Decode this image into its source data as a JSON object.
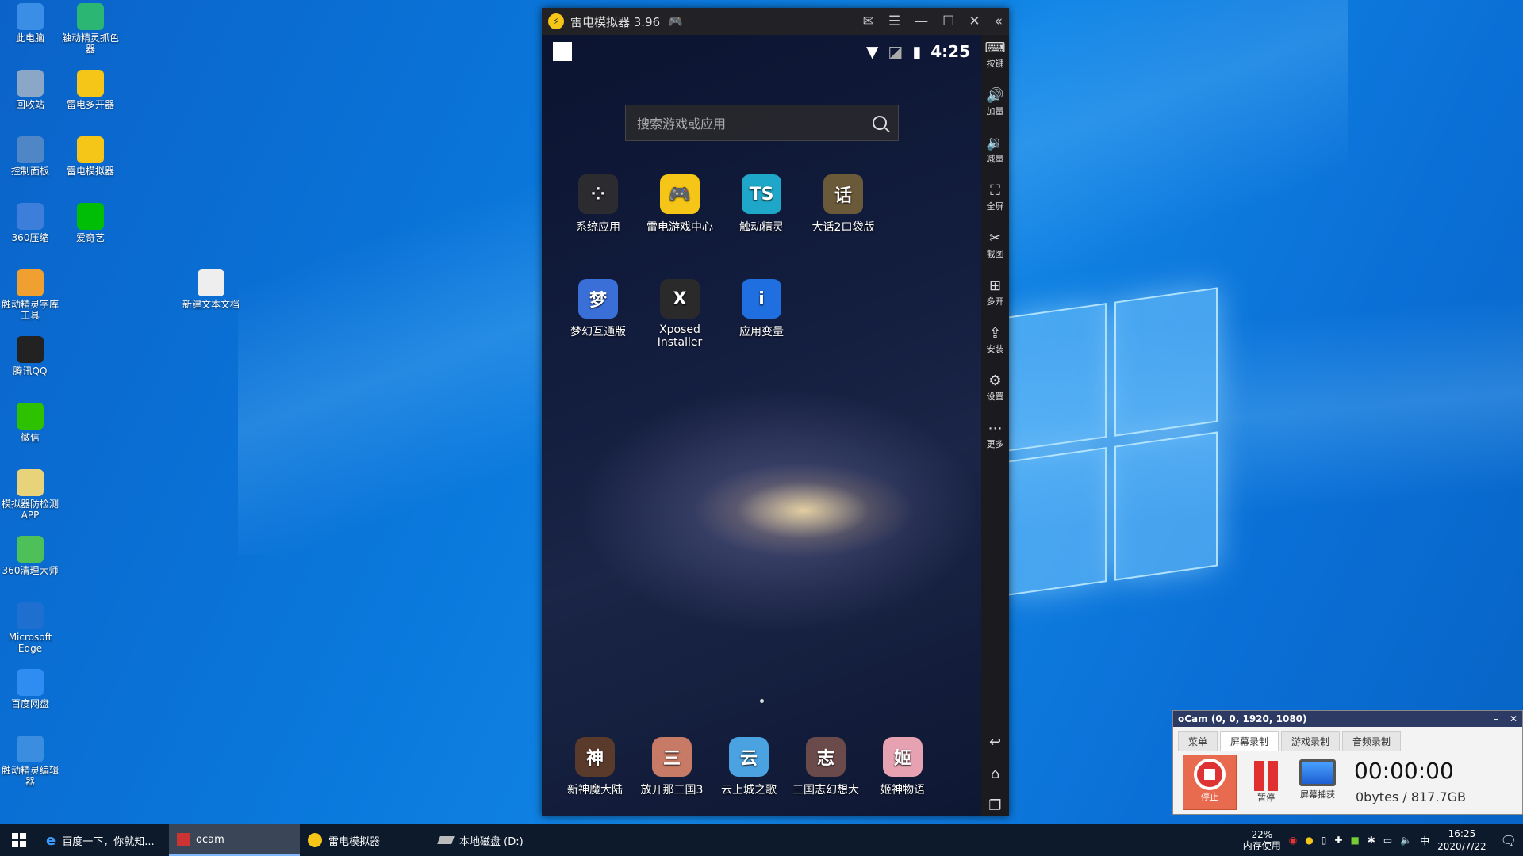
{
  "desktop": {
    "icons": [
      {
        "label": "此电脑",
        "icon": "computer-icon",
        "color": "#3a8ee6"
      },
      {
        "label": "触动精灵抓色器",
        "icon": "picker-icon",
        "color": "#2bb673"
      },
      {
        "label": "回收站",
        "icon": "recycle-bin-icon",
        "color": "#8aa7c7"
      },
      {
        "label": "雷电多开器",
        "icon": "multi-open-icon",
        "color": "#f5c518"
      },
      {
        "label": "控制面板",
        "icon": "control-panel-icon",
        "color": "#4f86c6"
      },
      {
        "label": "雷电模拟器",
        "icon": "ldplayer-icon",
        "color": "#f5c518"
      },
      {
        "label": "360压缩",
        "icon": "zip-icon",
        "color": "#3d7edb"
      },
      {
        "label": "爱奇艺",
        "icon": "iqiyi-icon",
        "color": "#00be06"
      },
      {
        "label": "触动精灵字库工具",
        "icon": "font-tool-icon",
        "color": "#f0a030"
      },
      {
        "label": "新建文本文档",
        "icon": "text-file-icon",
        "color": "#eeeeee"
      },
      {
        "label": "腾讯QQ",
        "icon": "qq-icon",
        "color": "#222222"
      },
      {
        "label": "微信",
        "icon": "wechat-icon",
        "color": "#2dc100"
      },
      {
        "label": "模拟器防检测APP",
        "icon": "app-file-icon",
        "color": "#e8d27a"
      },
      {
        "label": "360清理大师",
        "icon": "cleaner-icon",
        "color": "#4ec05a"
      },
      {
        "label": "Microsoft Edge",
        "icon": "edge-icon",
        "color": "#1f6fd1"
      },
      {
        "label": "百度网盘",
        "icon": "baidu-pan-icon",
        "color": "#2f8cf0"
      },
      {
        "label": "触动精灵编辑器",
        "icon": "editor-icon",
        "color": "#3b8de0"
      }
    ]
  },
  "emulator": {
    "title": "雷电模拟器 3.96",
    "time": "4:25",
    "search_placeholder": "搜索游戏或应用",
    "apps": [
      {
        "label": "系统应用",
        "color": "#2b2b30",
        "glyph": "⁘"
      },
      {
        "label": "雷电游戏中心",
        "color": "#f5c518",
        "glyph": "🎮"
      },
      {
        "label": "触动精灵",
        "color": "#1fa7c9",
        "glyph": "TS"
      },
      {
        "label": "大话2口袋版",
        "color": "#6b5a3a",
        "glyph": "话"
      },
      {
        "label": "梦幻互通版",
        "color": "#3a6fd8",
        "glyph": "梦"
      },
      {
        "label": "Xposed Installer",
        "color": "#2a2a2a",
        "glyph": "X"
      },
      {
        "label": "应用变量",
        "color": "#1f6fe0",
        "glyph": "i"
      }
    ],
    "dock": [
      {
        "label": "新神魔大陆",
        "color": "#5a3a2a",
        "glyph": "神"
      },
      {
        "label": "放开那三国3",
        "color": "#c77a66",
        "glyph": "三"
      },
      {
        "label": "云上城之歌",
        "color": "#4aa2e0",
        "glyph": "云"
      },
      {
        "label": "三国志幻想大",
        "color": "#6a4a4a",
        "glyph": "志"
      },
      {
        "label": "姬神物语",
        "color": "#e7a2b2",
        "glyph": "姬"
      }
    ],
    "side": [
      {
        "label": "按键",
        "glyph": "⌨"
      },
      {
        "label": "加量",
        "glyph": "🔊"
      },
      {
        "label": "减量",
        "glyph": "🔉"
      },
      {
        "label": "全屏",
        "glyph": "⛶"
      },
      {
        "label": "截图",
        "glyph": "✂"
      },
      {
        "label": "多开",
        "glyph": "⊞"
      },
      {
        "label": "安装",
        "glyph": "⇪"
      },
      {
        "label": "设置",
        "glyph": "⚙"
      },
      {
        "label": "更多",
        "glyph": "⋯"
      }
    ]
  },
  "ocam": {
    "title": "oCam (0, 0, 1920, 1080)",
    "tabs": [
      "菜单",
      "屏幕录制",
      "游戏录制",
      "音频录制"
    ],
    "stop_label": "停止",
    "pause_label": "暂停",
    "capture_label": "屏幕捕获",
    "timer": "00:00:00",
    "size": "0bytes / 817.7GB"
  },
  "taskbar": {
    "items": [
      "百度一下，你就知...",
      "ocam",
      "雷电模拟器",
      "本地磁盘 (D:)"
    ],
    "mem_percent": "22%",
    "mem_label": "内存使用",
    "ime": "中",
    "time": "16:25",
    "date": "2020/7/22"
  }
}
